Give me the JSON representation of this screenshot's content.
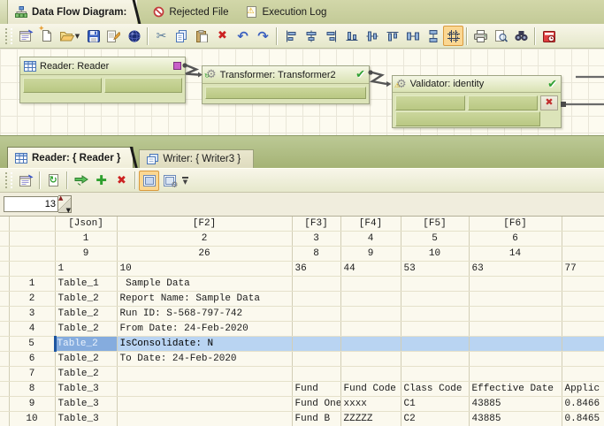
{
  "colors": {
    "tabbar_olive": "#C9CF9F",
    "toolbar_cream": "#EFEDD8",
    "canvas_bg": "#FDFBF0",
    "node_green": "#C5D295",
    "band_green": "#AFBF82",
    "active_tool_orange": "#FBD290",
    "selection_blue": "#B9D4F2",
    "selection_blue_dark": "#85ACDE",
    "check_green": "#2FA133",
    "error_red": "#C43434"
  },
  "top_tabs": [
    {
      "label": "Data Flow Diagram:",
      "icon": "dataflow-icon",
      "active": true
    },
    {
      "label": "Rejected File",
      "icon": "rejected-icon",
      "active": false
    },
    {
      "label": "Execution Log",
      "icon": "execution-log-icon",
      "active": false
    }
  ],
  "main_toolbar": {
    "icons": [
      "properties",
      "new",
      "open",
      "save",
      "edit",
      "publish",
      "cut",
      "copy",
      "paste",
      "delete",
      "undo",
      "redo",
      "align-left",
      "align-center",
      "align-right",
      "align-bottom",
      "align-middle",
      "align-top",
      "make-same-width",
      "make-same-height",
      "snap-to-grid",
      "print",
      "print-preview",
      "find",
      "schedule"
    ],
    "active_icon": "snap-to-grid"
  },
  "diagram": {
    "nodes": [
      {
        "title": "Reader: Reader",
        "status_icon": "breakpoint-square",
        "ports": 2
      },
      {
        "title": "Transformer: Transformer2",
        "status_icon": "check",
        "ports": 1
      },
      {
        "title": "Validator: identity",
        "status_icon": "check",
        "ports": 3,
        "has_error_button": true
      }
    ]
  },
  "bottom_panel": {
    "tabs": [
      {
        "label": "Reader: { Reader }",
        "icon": "table-icon",
        "active": true
      },
      {
        "label": "Writer: { Writer3 }",
        "icon": "writer-icon",
        "active": false
      }
    ],
    "toolbar_icons": [
      "properties",
      "refresh",
      "map-fields",
      "add",
      "delete",
      "preview-toggle",
      "options-toggle",
      "overflow"
    ],
    "active_toggle": "preview-toggle",
    "spinner_value": "13"
  },
  "grid": {
    "header_rows": [
      {
        "cells": [
          "[Json]",
          "[F2]",
          "[F3]",
          "[F4]",
          "[F5]",
          "[F6]",
          ""
        ]
      },
      {
        "cells": [
          "1",
          "2",
          "3",
          "4",
          "5",
          "6",
          ""
        ]
      },
      {
        "cells": [
          "9",
          "26",
          "8",
          "9",
          "10",
          "14",
          ""
        ]
      },
      {
        "cells": [
          "1",
          "10",
          "36",
          "44",
          "53",
          "63",
          "77"
        ]
      }
    ],
    "rows": [
      {
        "n": "1",
        "c": [
          "Table_1",
          " Sample Data",
          "",
          "",
          "",
          "",
          ""
        ]
      },
      {
        "n": "2",
        "c": [
          "Table_2",
          "Report Name: Sample Data",
          "",
          "",
          "",
          "",
          ""
        ]
      },
      {
        "n": "3",
        "c": [
          "Table_2",
          "Run ID: S-568-797-742",
          "",
          "",
          "",
          "",
          ""
        ]
      },
      {
        "n": "4",
        "c": [
          "Table_2",
          "From Date: 24-Feb-2020",
          "",
          "",
          "",
          "",
          ""
        ]
      },
      {
        "n": "5",
        "c": [
          "Table_2",
          "IsConsolidate: N",
          "",
          "",
          "",
          "",
          ""
        ],
        "selected": true
      },
      {
        "n": "6",
        "c": [
          "Table_2",
          "To Date: 24-Feb-2020",
          "",
          "",
          "",
          "",
          ""
        ]
      },
      {
        "n": "7",
        "c": [
          "Table_2",
          "",
          "",
          "",
          "",
          "",
          ""
        ]
      },
      {
        "n": "8",
        "c": [
          "Table_3",
          "",
          "Fund",
          "Fund Code",
          "Class Code",
          "Effective Date",
          "Applic"
        ]
      },
      {
        "n": "9",
        "c": [
          "Table_3",
          "",
          "Fund One",
          "xxxx",
          "C1",
          "43885",
          "0.8466"
        ]
      },
      {
        "n": "10",
        "c": [
          "Table_3",
          "",
          "Fund B",
          "ZZZZZ",
          "C2",
          "43885",
          "0.8465"
        ]
      }
    ]
  }
}
